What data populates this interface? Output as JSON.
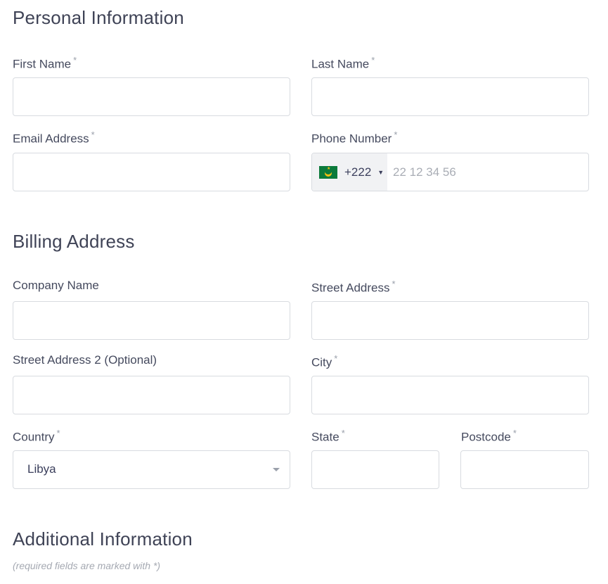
{
  "sections": {
    "personal": "Personal Information",
    "billing": "Billing Address",
    "additional": "Additional Information"
  },
  "required_marker": "*",
  "fields": {
    "first_name": {
      "label": "First Name",
      "value": ""
    },
    "last_name": {
      "label": "Last Name",
      "value": ""
    },
    "email": {
      "label": "Email Address",
      "value": ""
    },
    "phone": {
      "label": "Phone Number",
      "dial_code": "+222",
      "placeholder": "22 12 34 56",
      "value": "",
      "flag_icon": "mauritania-flag-icon"
    },
    "company": {
      "label": "Company Name",
      "value": ""
    },
    "street": {
      "label": "Street Address",
      "value": ""
    },
    "street2": {
      "label": "Street Address 2 (Optional)",
      "value": ""
    },
    "city": {
      "label": "City",
      "value": ""
    },
    "country": {
      "label": "Country",
      "value": "Libya"
    },
    "state": {
      "label": "State",
      "value": ""
    },
    "postcode": {
      "label": "Postcode",
      "value": ""
    }
  },
  "note": "(required fields are marked with *)",
  "colors": {
    "border": "#d8dbe0",
    "text": "#3b3f5c",
    "muted": "#a5a9b2",
    "prefix_bg": "#f1f2f4"
  }
}
